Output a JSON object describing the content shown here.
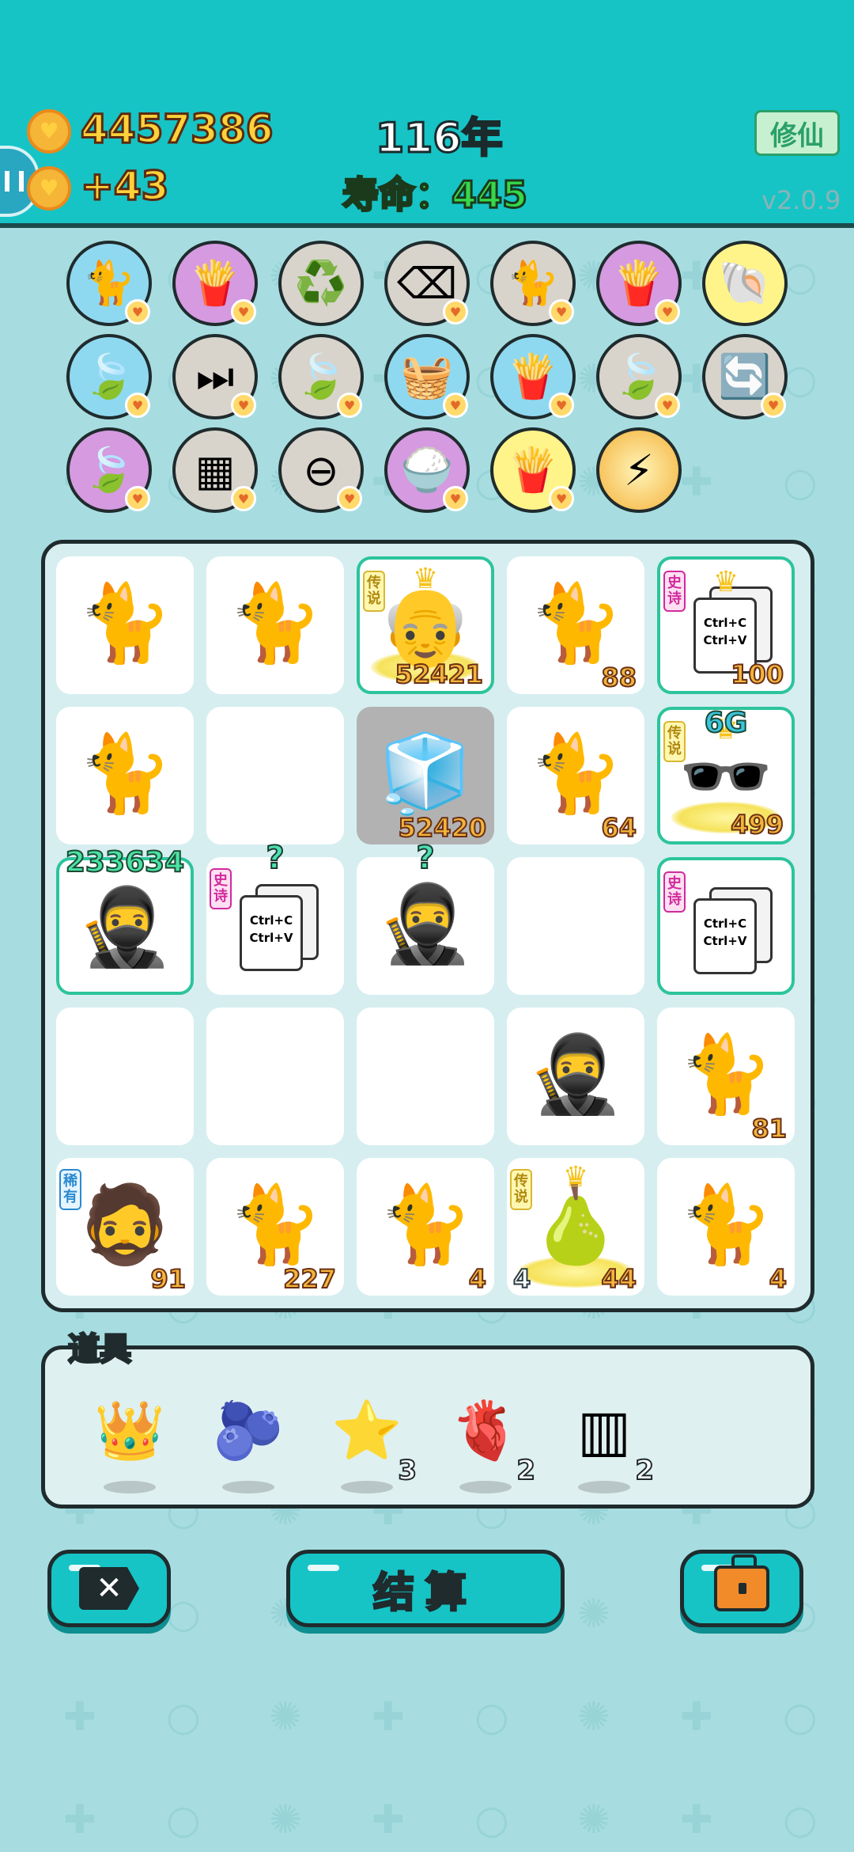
{
  "header": {
    "coins": "4457386",
    "coin_rate": "+43",
    "year": "116年",
    "lifespan": "寿命：445",
    "cultivate_label": "修仙",
    "version": "v2.0.9"
  },
  "skills": [
    {
      "name": "cat-unit",
      "icon": "🐈",
      "color": "blue",
      "badge": true
    },
    {
      "name": "fries",
      "icon": "🍟",
      "color": "purple",
      "badge": true
    },
    {
      "name": "recycle",
      "icon": "♻️",
      "color": "grey",
      "badge": false
    },
    {
      "name": "delete",
      "icon": "⌫",
      "color": "grey",
      "badge": true
    },
    {
      "name": "cat-pair",
      "icon": "🐈",
      "color": "grey",
      "badge": true
    },
    {
      "name": "fries",
      "icon": "🍟",
      "color": "purple",
      "badge": true
    },
    {
      "name": "shell",
      "icon": "🐚",
      "color": "yellow",
      "badge": false
    },
    {
      "name": "leaf",
      "icon": "🍃",
      "color": "blue",
      "badge": true
    },
    {
      "name": "skip",
      "icon": "⏭",
      "color": "grey",
      "badge": true
    },
    {
      "name": "leaf",
      "icon": "🍃",
      "color": "grey",
      "badge": true
    },
    {
      "name": "fruit-basket",
      "icon": "🧺",
      "color": "blue",
      "badge": true
    },
    {
      "name": "fries",
      "icon": "🍟",
      "color": "blue",
      "badge": true
    },
    {
      "name": "leaf",
      "icon": "🍃",
      "color": "grey",
      "badge": true
    },
    {
      "name": "refresh",
      "icon": "🔄",
      "color": "grey",
      "badge": true
    },
    {
      "name": "leaf",
      "icon": "🍃",
      "color": "purple",
      "badge": true
    },
    {
      "name": "sugar-cubes",
      "icon": "▦",
      "color": "grey",
      "badge": true
    },
    {
      "name": "minus",
      "icon": "⊖",
      "color": "grey",
      "badge": true
    },
    {
      "name": "rice-bowl",
      "icon": "🍚",
      "color": "purple",
      "badge": true
    },
    {
      "name": "fries",
      "icon": "🍟",
      "color": "yellow",
      "badge": true
    },
    {
      "name": "lightning",
      "icon": "⚡",
      "color": "orange",
      "badge": false
    }
  ],
  "board": {
    "tiles": [
      {
        "type": "cat",
        "num": ""
      },
      {
        "type": "cat",
        "num": ""
      },
      {
        "type": "king",
        "num": "52421",
        "rank": "传说",
        "rank_type": "legend",
        "special": true
      },
      {
        "type": "cat",
        "num": "88"
      },
      {
        "type": "copy",
        "num": "100",
        "rank": "史诗",
        "rank_type": "epic",
        "special": true,
        "crown": true
      },
      {
        "type": "cat",
        "num": ""
      },
      {
        "type": "empty"
      },
      {
        "type": "fridge",
        "num": "52420",
        "gray": true
      },
      {
        "type": "cat",
        "num": "64"
      },
      {
        "type": "boss",
        "num": "499",
        "rank": "传说",
        "rank_type": "legend",
        "special": true,
        "top": "6G"
      },
      {
        "type": "thief",
        "num": "",
        "special": true,
        "top": "233634"
      },
      {
        "type": "copy",
        "num": "",
        "rank": "史诗",
        "rank_type": "epic",
        "q": "?"
      },
      {
        "type": "thief",
        "num": "",
        "q": "?"
      },
      {
        "type": "empty"
      },
      {
        "type": "copy",
        "num": "",
        "rank": "史诗",
        "rank_type": "epic",
        "special": true
      },
      {
        "type": "empty"
      },
      {
        "type": "empty"
      },
      {
        "type": "empty"
      },
      {
        "type": "thief",
        "num": ""
      },
      {
        "type": "cat",
        "num": "81"
      },
      {
        "type": "man",
        "num": "91",
        "rank": "稀有",
        "rank_type": "rare"
      },
      {
        "type": "cat",
        "num": "227"
      },
      {
        "type": "cat",
        "num": "4"
      },
      {
        "type": "pear",
        "num": "44",
        "num_left": "4",
        "rank": "传说",
        "rank_type": "legend"
      },
      {
        "type": "cat",
        "num": "4"
      }
    ],
    "copy_card_text": [
      "Ctrl+C",
      "Ctrl+V"
    ]
  },
  "items": {
    "title": "道具",
    "list": [
      {
        "name": "crown",
        "icon": "👑",
        "count": ""
      },
      {
        "name": "blueberry",
        "icon": "🫐",
        "count": ""
      },
      {
        "name": "star",
        "icon": "⭐",
        "count": "3"
      },
      {
        "name": "liver",
        "icon": "🫀",
        "count": "2"
      },
      {
        "name": "test-tubes",
        "icon": "▥",
        "count": "2"
      }
    ]
  },
  "buttons": {
    "close": "✕",
    "settle": "结算"
  },
  "colors": {
    "header": "#16c4c6",
    "background": "#a7dde0",
    "gold": "#ffd13a",
    "life_green": "#36d84a"
  }
}
